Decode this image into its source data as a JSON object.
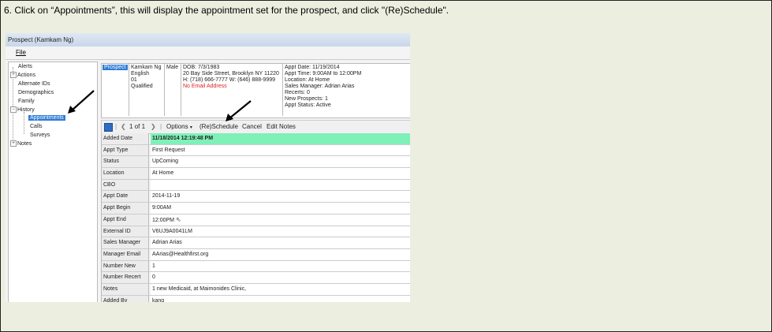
{
  "instruction": "6. Click on “Appointments”, this will display the appointment set for the prospect, and click \"(Re)Schedule\".",
  "window": {
    "title": "Prospect (Kamkam Ng)",
    "menu": [
      "File"
    ]
  },
  "tree": {
    "items": [
      {
        "label": "Alerts",
        "expander": ""
      },
      {
        "label": "Actions",
        "expander": "+"
      },
      {
        "label": "Alternate IDs",
        "expander": ""
      },
      {
        "label": "Demographics",
        "expander": ""
      },
      {
        "label": "Family",
        "expander": ""
      },
      {
        "label": "History",
        "expander": "−"
      },
      {
        "label": "Appointments",
        "expander": ""
      },
      {
        "label": "Calls",
        "expander": ""
      },
      {
        "label": "Surveys",
        "expander": ""
      },
      {
        "label": "Notes",
        "expander": "+"
      }
    ]
  },
  "info": {
    "tag": "Prospect",
    "name_lines": [
      "Kamkam Ng",
      "English",
      "01",
      "Qualified"
    ],
    "gender": "Male",
    "contact_lines": [
      "DOB: 7/3/1983",
      "20 Bay Side Street, Brooklyn NY 11220",
      "H: (718) 666-7777 W: (646) 888-9999"
    ],
    "no_email": "No Email Address",
    "appt_lines": [
      "Appt Date: 11/19/2014",
      "Appt Time: 9:00AM to 12:00PM",
      "Location: At Home",
      "Sales Manager: Adrian Arias",
      "Recerts: 0",
      "New Prospects: 1",
      "Appt Status: Active"
    ]
  },
  "toolbar": {
    "pager": "1 of 1",
    "options": "Options",
    "reschedule": "(Re)Schedule",
    "cancel": "Cancel",
    "edit_notes": "Edit Notes"
  },
  "details": [
    {
      "label": "Added Date",
      "value": "11/18/2014 12:19:48 PM"
    },
    {
      "label": "Appt Type",
      "value": "First Request"
    },
    {
      "label": "Status",
      "value": "UpComing"
    },
    {
      "label": "Location",
      "value": "At Home"
    },
    {
      "label": "CBO",
      "value": ""
    },
    {
      "label": "Appt Date",
      "value": "2014-11-19"
    },
    {
      "label": "Appt Begin",
      "value": "9:00AM"
    },
    {
      "label": "Appt End",
      "value": "12:00PM"
    },
    {
      "label": "External ID",
      "value": "V6UJ9A0041LM"
    },
    {
      "label": "Sales Manager",
      "value": "Adrian Arias"
    },
    {
      "label": "Manager Email",
      "value": "AArias@Healthfirst.org"
    },
    {
      "label": "Number New",
      "value": "1"
    },
    {
      "label": "Number Recert",
      "value": "0"
    },
    {
      "label": "Notes",
      "value": "1 new Medicaid, at Maimonides Clinic,"
    },
    {
      "label": "Added By",
      "value": "kang"
    }
  ],
  "colors": {
    "selection": "#2e7bd6",
    "highlight": "#7ff0b8",
    "background": "#eceee0"
  }
}
